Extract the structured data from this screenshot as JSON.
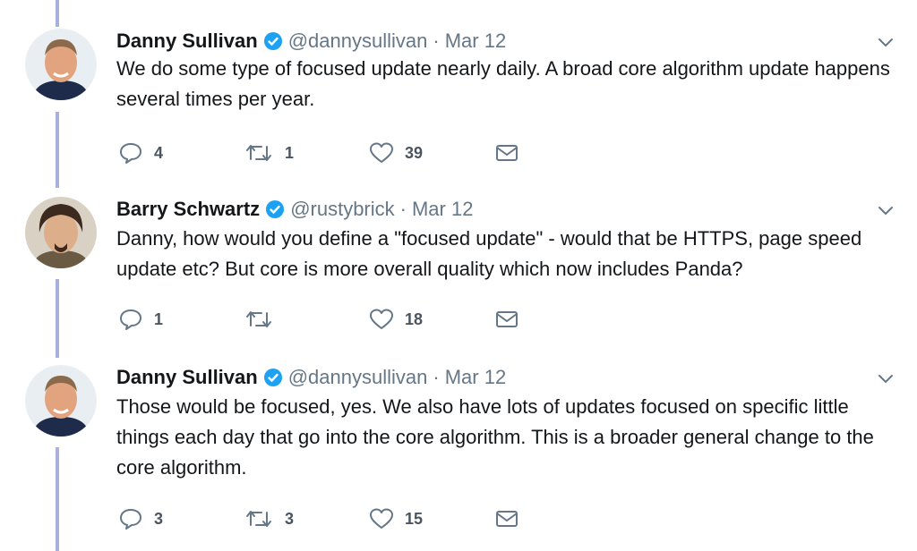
{
  "tweets": [
    {
      "name": "Danny Sullivan",
      "handle": "@dannysullivan",
      "separator": "·",
      "date": "Mar 12",
      "text": "We do some type of focused update nearly daily. A broad core algorithm update happens several times per year.",
      "replies": "4",
      "retweets": "1",
      "likes": "39"
    },
    {
      "name": "Barry Schwartz",
      "handle": "@rustybrick",
      "separator": "·",
      "date": "Mar 12",
      "text": "Danny, how would you define a \"focused update\" - would that be HTTPS, page speed update etc?  But core is more overall quality which now includes Panda?",
      "replies": "1",
      "retweets": "",
      "likes": "18"
    },
    {
      "name": "Danny Sullivan",
      "handle": "@dannysullivan",
      "separator": "·",
      "date": "Mar 12",
      "text": "Those would be focused, yes. We also have lots of updates focused on specific little things each day that go into the core algorithm. This is a broader general change to the core algorithm.",
      "replies": "3",
      "retweets": "3",
      "likes": "15"
    }
  ],
  "colors": {
    "thread_line": "#a9b0de",
    "verified": "#1da1f2",
    "muted": "#657786"
  },
  "icons": [
    "reply-icon",
    "retweet-icon",
    "like-icon",
    "message-icon",
    "verified-icon",
    "chevron-down-icon"
  ]
}
